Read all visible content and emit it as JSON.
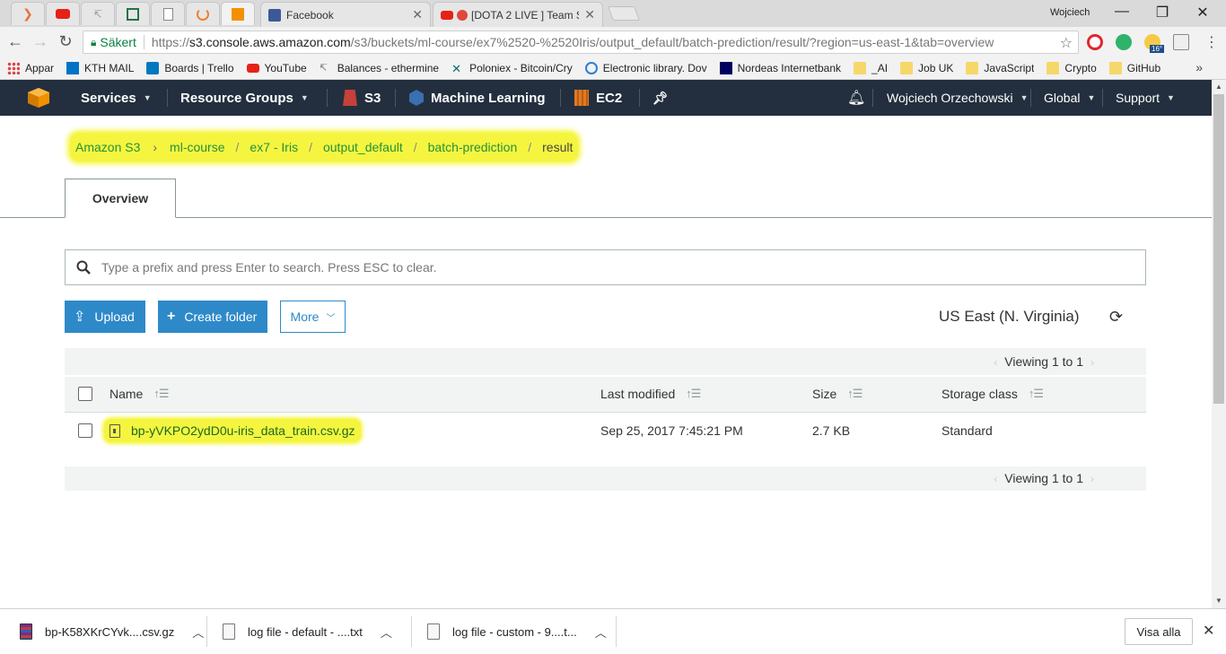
{
  "browser": {
    "tabs": [
      {
        "title": "Facebook"
      },
      {
        "title": "[DOTA 2 LIVE ] Team S"
      }
    ],
    "profile_name": "Wojciech",
    "address": {
      "secure_label": "Säkert",
      "url_scheme": "https://",
      "url_host": "s3.console.aws.amazon.com",
      "url_path": "/s3/buckets/ml-course/ex7%2520-%2520Iris/output_default/batch-prediction/result/?region=us-east-1&tab=overview"
    },
    "bookmarks": [
      {
        "label": "Appar",
        "icon": "apps-grid-icon"
      },
      {
        "label": "KTH MAIL",
        "icon": "outlook-icon"
      },
      {
        "label": "Boards | Trello",
        "icon": "trello-icon"
      },
      {
        "label": "YouTube",
        "icon": "youtube-icon"
      },
      {
        "label": "Balances - ethermine",
        "icon": "ethermine-icon"
      },
      {
        "label": "Poloniex - Bitcoin/Cry",
        "icon": "poloniex-icon"
      },
      {
        "label": "Electronic library. Dov",
        "icon": "globe-icon"
      },
      {
        "label": "Nordeas Internetbank",
        "icon": "nordea-icon"
      },
      {
        "label": "_AI",
        "icon": "folder-icon"
      },
      {
        "label": "Job UK",
        "icon": "folder-icon"
      },
      {
        "label": "JavaScript",
        "icon": "folder-icon"
      },
      {
        "label": "Crypto",
        "icon": "folder-icon"
      },
      {
        "label": "GitHub",
        "icon": "folder-icon"
      }
    ],
    "bookmarks_more": "»",
    "weather_badge": "16°"
  },
  "aws_nav": {
    "services": "Services",
    "resource_groups": "Resource Groups",
    "s3": "S3",
    "machine_learning": "Machine Learning",
    "ec2": "EC2",
    "user": "Wojciech Orzechowski",
    "region": "Global",
    "support": "Support"
  },
  "breadcrumb": {
    "root": "Amazon S3",
    "items": [
      "ml-course",
      "ex7 - Iris",
      "output_default",
      "batch-prediction"
    ],
    "current": "result"
  },
  "tabs": {
    "overview": "Overview"
  },
  "search": {
    "placeholder": "Type a prefix and press Enter to search. Press ESC to clear."
  },
  "actions": {
    "upload": "Upload",
    "create_folder": "Create folder",
    "more": "More",
    "region_label": "US East (N. Virginia)"
  },
  "table": {
    "viewing_top": "Viewing 1 to 1",
    "viewing_bottom": "Viewing 1 to 1",
    "columns": {
      "name": "Name",
      "last_modified": "Last modified",
      "size": "Size",
      "storage_class": "Storage class"
    },
    "rows": [
      {
        "name": "bp-yVKPO2ydD0u-iris_data_train.csv.gz",
        "last_modified": "Sep 25, 2017 7:45:21 PM",
        "size": "2.7 KB",
        "storage_class": "Standard"
      }
    ]
  },
  "downloads": {
    "items": [
      {
        "label": "bp-K58XKrCYvk....csv.gz"
      },
      {
        "label": "log file - default - ....txt"
      },
      {
        "label": "log file - custom - 9....t..."
      }
    ],
    "show_all": "Visa alla"
  },
  "colors": {
    "aws_nav_bg": "#232f3e",
    "primary_button": "#2e89c9",
    "highlight": "#f5f540",
    "link_green": "#27913a"
  }
}
